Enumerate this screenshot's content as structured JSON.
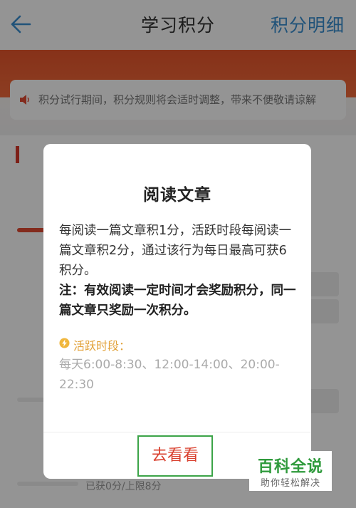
{
  "header": {
    "title": "学习积分",
    "detail_link": "积分明细"
  },
  "modal": {
    "title": "阅读文章",
    "body": "每阅读一篇文章积1分，活跃时段每阅读一篇文章积2分，通过该行为每日最高可获6积分。",
    "note": "注：有效阅读一定时间才会奖励积分，同一篇文章只奖励一次积分。",
    "active_label": "活跃时段：",
    "active_time": "每天6:00-8:30、12:00-14:00、20:00-22:30",
    "go_button": "去看看"
  },
  "background": {
    "notice": "积分试行期间，积分规则将会适时调整，带来不便敬请谅解",
    "last_progress": "已获0分/上限8分"
  },
  "watermark": {
    "main": "百科全说",
    "sub": "助你轻松解决"
  },
  "colors": {
    "accent_red": "#d8382a",
    "link_blue": "#3a8fd1",
    "active_yellow": "#e2a23a",
    "button_border_green": "#3ca448"
  }
}
